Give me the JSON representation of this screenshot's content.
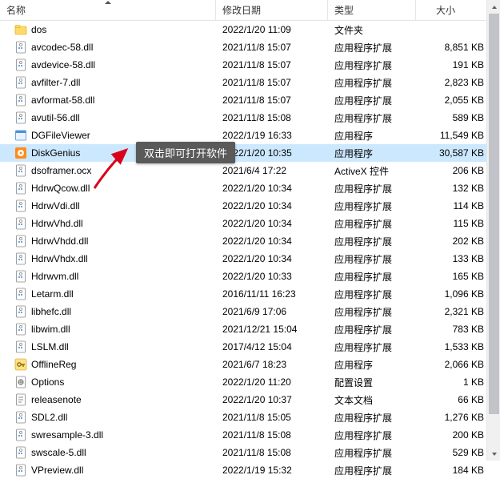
{
  "columns": {
    "name": "名称",
    "date": "修改日期",
    "type": "类型",
    "size": "大小"
  },
  "tooltip": "双击即可打开软件",
  "selected_index": 7,
  "rows": [
    {
      "icon": "folder",
      "name": "dos",
      "date": "2022/1/20 11:09",
      "type": "文件夹",
      "size": ""
    },
    {
      "icon": "dll",
      "name": "avcodec-58.dll",
      "date": "2021/11/8 15:07",
      "type": "应用程序扩展",
      "size": "8,851 KB"
    },
    {
      "icon": "dll",
      "name": "avdevice-58.dll",
      "date": "2021/11/8 15:07",
      "type": "应用程序扩展",
      "size": "191 KB"
    },
    {
      "icon": "dll",
      "name": "avfilter-7.dll",
      "date": "2021/11/8 15:07",
      "type": "应用程序扩展",
      "size": "2,823 KB"
    },
    {
      "icon": "dll",
      "name": "avformat-58.dll",
      "date": "2021/11/8 15:07",
      "type": "应用程序扩展",
      "size": "2,055 KB"
    },
    {
      "icon": "dll",
      "name": "avutil-56.dll",
      "date": "2021/11/8 15:08",
      "type": "应用程序扩展",
      "size": "589 KB"
    },
    {
      "icon": "exe",
      "name": "DGFileViewer",
      "date": "2022/1/19 16:33",
      "type": "应用程序",
      "size": "11,549 KB"
    },
    {
      "icon": "dg",
      "name": "DiskGenius",
      "date": "2022/1/20 10:35",
      "type": "应用程序",
      "size": "30,587 KB"
    },
    {
      "icon": "dll",
      "name": "dsoframer.ocx",
      "date": "2021/6/4 17:22",
      "type": "ActiveX 控件",
      "size": "206 KB"
    },
    {
      "icon": "dll",
      "name": "HdrwQcow.dll",
      "date": "2022/1/20 10:34",
      "type": "应用程序扩展",
      "size": "132 KB"
    },
    {
      "icon": "dll",
      "name": "HdrwVdi.dll",
      "date": "2022/1/20 10:34",
      "type": "应用程序扩展",
      "size": "114 KB"
    },
    {
      "icon": "dll",
      "name": "HdrwVhd.dll",
      "date": "2022/1/20 10:34",
      "type": "应用程序扩展",
      "size": "115 KB"
    },
    {
      "icon": "dll",
      "name": "HdrwVhdd.dll",
      "date": "2022/1/20 10:34",
      "type": "应用程序扩展",
      "size": "202 KB"
    },
    {
      "icon": "dll",
      "name": "HdrwVhdx.dll",
      "date": "2022/1/20 10:34",
      "type": "应用程序扩展",
      "size": "133 KB"
    },
    {
      "icon": "dll",
      "name": "Hdrwvm.dll",
      "date": "2022/1/20 10:33",
      "type": "应用程序扩展",
      "size": "165 KB"
    },
    {
      "icon": "dll",
      "name": "Letarm.dll",
      "date": "2016/11/11 16:23",
      "type": "应用程序扩展",
      "size": "1,096 KB"
    },
    {
      "icon": "dll",
      "name": "libhefc.dll",
      "date": "2021/6/9 17:06",
      "type": "应用程序扩展",
      "size": "2,321 KB"
    },
    {
      "icon": "dll",
      "name": "libwim.dll",
      "date": "2021/12/21 15:04",
      "type": "应用程序扩展",
      "size": "783 KB"
    },
    {
      "icon": "dll",
      "name": "LSLM.dll",
      "date": "2017/4/12 15:04",
      "type": "应用程序扩展",
      "size": "1,533 KB"
    },
    {
      "icon": "key",
      "name": "OfflineReg",
      "date": "2021/6/7 18:23",
      "type": "应用程序",
      "size": "2,066 KB"
    },
    {
      "icon": "ini",
      "name": "Options",
      "date": "2022/1/20 11:20",
      "type": "配置设置",
      "size": "1 KB"
    },
    {
      "icon": "txt",
      "name": "releasenote",
      "date": "2022/1/20 10:37",
      "type": "文本文档",
      "size": "66 KB"
    },
    {
      "icon": "dll",
      "name": "SDL2.dll",
      "date": "2021/11/8 15:05",
      "type": "应用程序扩展",
      "size": "1,276 KB"
    },
    {
      "icon": "dll",
      "name": "swresample-3.dll",
      "date": "2021/11/8 15:08",
      "type": "应用程序扩展",
      "size": "200 KB"
    },
    {
      "icon": "dll",
      "name": "swscale-5.dll",
      "date": "2021/11/8 15:08",
      "type": "应用程序扩展",
      "size": "529 KB"
    },
    {
      "icon": "dll",
      "name": "VPreview.dll",
      "date": "2022/1/19 15:32",
      "type": "应用程序扩展",
      "size": "184 KB"
    }
  ]
}
